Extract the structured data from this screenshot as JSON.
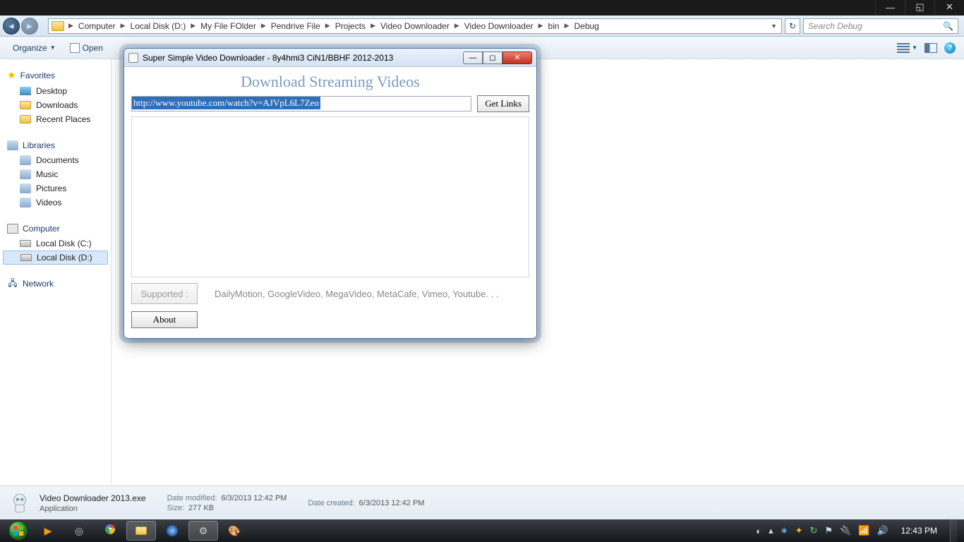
{
  "titlebar_buttons": {
    "min": "—",
    "max": "◱",
    "close": "✕"
  },
  "breadcrumb": [
    "Computer",
    "Local Disk (D:)",
    "My File FOlder",
    "Pendrive File",
    "Projects",
    "Video Downloader",
    "Video Downloader",
    "bin",
    "Debug"
  ],
  "search_placeholder": "Search Debug",
  "toolbar": {
    "organize": "Organize",
    "open": "Open"
  },
  "sidebar": {
    "favorites": {
      "label": "Favorites",
      "items": [
        "Desktop",
        "Downloads",
        "Recent Places"
      ]
    },
    "libraries": {
      "label": "Libraries",
      "items": [
        "Documents",
        "Music",
        "Pictures",
        "Videos"
      ]
    },
    "computer": {
      "label": "Computer",
      "items": [
        "Local Disk (C:)",
        "Local Disk (D:)"
      ],
      "selected": 1
    },
    "network": {
      "label": "Network"
    }
  },
  "details": {
    "filename": "Video Downloader 2013.exe",
    "apptype": "Application",
    "date_modified_label": "Date modified:",
    "date_modified": "6/3/2013 12:42 PM",
    "size_label": "Size:",
    "size": "277 KB",
    "date_created_label": "Date created:",
    "date_created": "6/3/2013 12:42 PM"
  },
  "taskbar": {
    "clock": "12:43 PM"
  },
  "app": {
    "title": "Super Simple Video Downloader - 8y4hmi3 CiN1/BBHF 2012-2013",
    "header": "Download Streaming Videos",
    "url": "http://www.youtube.com/watch?v=AJVpL6L7Zeo",
    "getlinks": "Get Links",
    "supported_label": "Supported :",
    "supported_list": "DailyMotion, GoogleVideo, MegaVideo, MetaCafe, Vimeo, Youtube. . .",
    "about": "About"
  }
}
